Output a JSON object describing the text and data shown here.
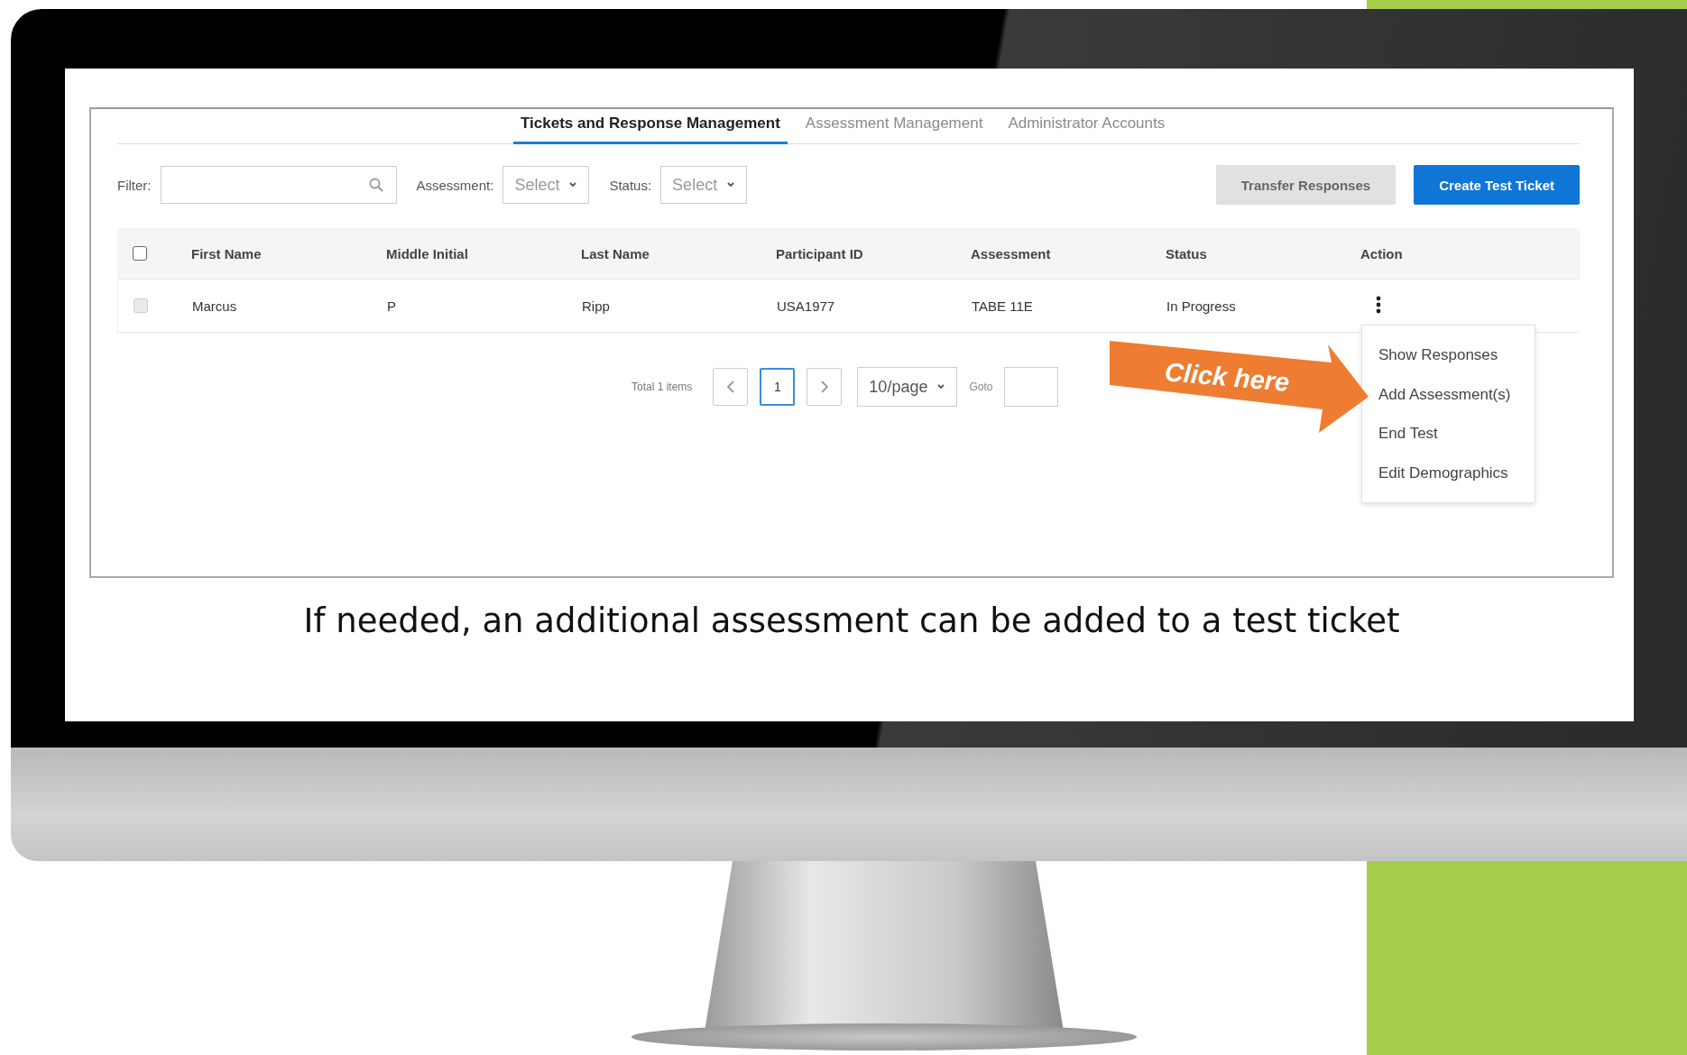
{
  "tabs": [
    {
      "label": "Tickets and Response Management",
      "selected": true
    },
    {
      "label": "Assessment Management",
      "selected": false
    },
    {
      "label": "Administrator Accounts",
      "selected": false
    }
  ],
  "filter": {
    "label": "Filter:"
  },
  "assessment_filter": {
    "label": "Assessment:",
    "placeholder": "Select"
  },
  "status_filter": {
    "label": "Status:",
    "placeholder": "Select"
  },
  "buttons": [
    {
      "label": "Transfer Responses",
      "kind": "secondary"
    },
    {
      "label": "Create Test Ticket",
      "kind": "primary"
    }
  ],
  "table": {
    "header_checked": false,
    "columns": [
      "First Name",
      "Middle Initial",
      "Last Name",
      "Participant ID",
      "Assessment",
      "Status",
      "Action"
    ],
    "rows": [
      {
        "checked": false,
        "disabled": true,
        "cells": [
          "Marcus",
          "P",
          "Ripp",
          "USA1977",
          "TABE 11E",
          "In Progress"
        ]
      }
    ]
  },
  "pagination": {
    "total": "Total 1 items",
    "pages": [
      {
        "label": "1",
        "selected": true
      }
    ],
    "page_size": "10/page",
    "goto_label": "Goto"
  },
  "action_menu": {
    "items": [
      "Show Responses",
      "Add Assessment(s)",
      "End Test",
      "Edit Demographics"
    ]
  },
  "callout": {
    "text": "Click here"
  },
  "caption": "If needed, an additional assessment can be added to a test ticket"
}
